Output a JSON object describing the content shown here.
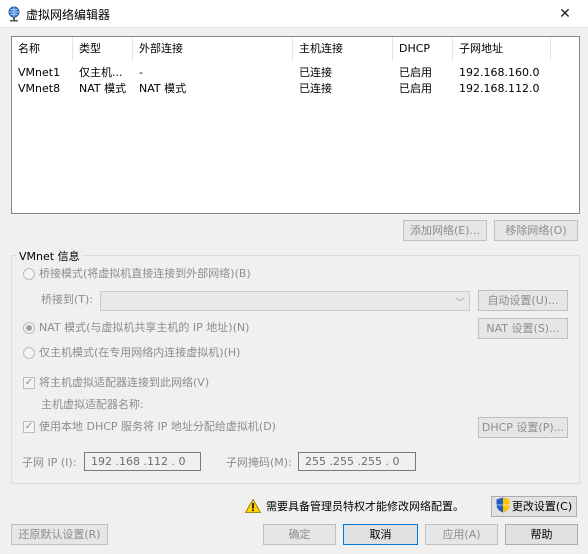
{
  "window": {
    "title": "虚拟网络编辑器",
    "close_glyph": "✕"
  },
  "network_table": {
    "columns": [
      "名称",
      "类型",
      "外部连接",
      "主机连接",
      "DHCP",
      "子网地址"
    ],
    "rows": [
      [
        "VMnet1",
        "仅主机...",
        "-",
        "已连接",
        "已启用",
        "192.168.160.0"
      ],
      [
        "VMnet8",
        "NAT 模式",
        "NAT 模式",
        "已连接",
        "已启用",
        "192.168.112.0"
      ]
    ]
  },
  "table_buttons": {
    "add": "添加网络(E)...",
    "remove": "移除网络(O)"
  },
  "vmnet_info": {
    "title": "VMnet 信息",
    "bridged": {
      "label": "桥接模式(将虚拟机直接连接到外部网络)(B)",
      "checked": false
    },
    "bridge_to_label": "桥接到(T):",
    "bridge_to_value": "",
    "auto_settings": "自动设置(U)...",
    "nat": {
      "label": "NAT 模式(与虚拟机共享主机的 IP 地址)(N)",
      "checked": true
    },
    "nat_settings": "NAT 设置(S)...",
    "host_only": {
      "label": "仅主机模式(在专用网络内连接虚拟机)(H)",
      "checked": false
    },
    "connect_adapter": {
      "label": "将主机虚拟适配器连接到此网络(V)",
      "checked": true
    },
    "adapter_name_label": "主机虚拟适配器名称:",
    "use_dhcp": {
      "label": "使用本地 DHCP 服务将 IP 地址分配给虚拟机(D)",
      "checked": true
    },
    "dhcp_settings": "DHCP 设置(P)...",
    "subnet_ip_label": "子网 IP (I):",
    "subnet_ip": "192 .168 .112 . 0",
    "subnet_mask_label": "子网掩码(M):",
    "subnet_mask": "255 .255 .255 . 0"
  },
  "admin_notice": "需要具备管理员特权才能修改网络配置。",
  "change_settings": "更改设置(C)",
  "footer": {
    "restore": "还原默认设置(R)",
    "ok": "确定",
    "cancel": "取消",
    "apply": "应用(A)",
    "help": "帮助"
  },
  "colors": {
    "accent": "#0078d7",
    "disabled_text": "#8d8d8d",
    "warning": "#ffd200"
  }
}
